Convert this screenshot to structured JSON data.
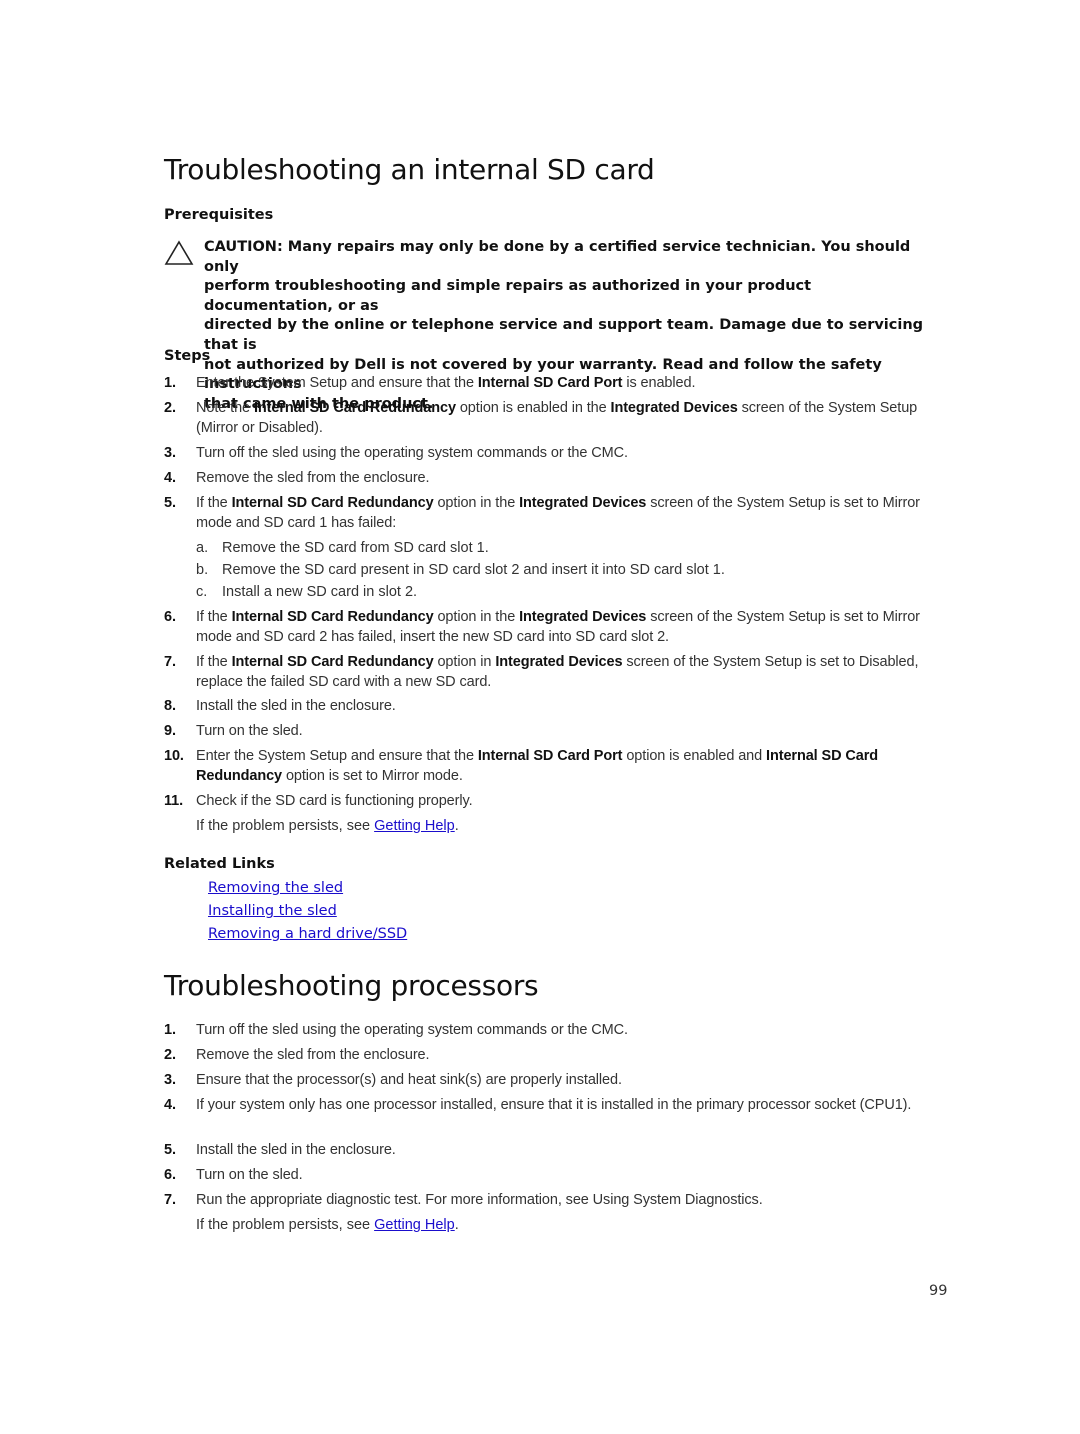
{
  "section1": {
    "title": "Troubleshooting an internal SD card",
    "prerequisites_label": "Prerequisites",
    "caution": {
      "icon": "caution-triangle-icon",
      "lines": [
        "CAUTION: Many repairs may only be done by a certified service technician. You should only",
        "perform troubleshooting and simple repairs as authorized in your product documentation, or as",
        "directed by the online or telephone service and support team. Damage due to servicing that is",
        "not authorized by Dell is not covered by your warranty. Read and follow the safety instructions",
        "that came with the product."
      ]
    },
    "steps_label": "Steps",
    "steps": [
      {
        "num": "1.",
        "parts": [
          [
            "t",
            "Enter the System Setup and ensure that the "
          ],
          [
            "b",
            "Internal SD Card Port"
          ],
          [
            "t",
            " is enabled."
          ]
        ]
      },
      {
        "num": "2.",
        "parts": [
          [
            "t",
            "Note the "
          ],
          [
            "b",
            "Internal SD Card Redundancy"
          ],
          [
            "t",
            " option is enabled in the "
          ],
          [
            "b",
            "Integrated Devices"
          ],
          [
            "t",
            " screen of the System Setup (Mirror or Disabled)."
          ]
        ]
      },
      {
        "num": "3.",
        "parts": [
          [
            "t",
            "Turn off the sled using the operating system commands or the CMC."
          ]
        ]
      },
      {
        "num": "4.",
        "parts": [
          [
            "t",
            "Remove the sled from the enclosure."
          ]
        ]
      },
      {
        "num": "5.",
        "parts": [
          [
            "t",
            "If the "
          ],
          [
            "b",
            "Internal SD Card Redundancy"
          ],
          [
            "t",
            " option in the "
          ],
          [
            "b",
            "Integrated Devices"
          ],
          [
            "t",
            " screen of the System Setup is set to Mirror mode and SD card 1 has failed:"
          ]
        ],
        "substeps": [
          {
            "letter": "a.",
            "text": "Remove the SD card from SD card slot 1."
          },
          {
            "letter": "b.",
            "text": "Remove the SD card present in SD card slot 2 and insert it into SD card slot 1."
          },
          {
            "letter": "c.",
            "text": "Install a new SD card in slot 2."
          }
        ]
      },
      {
        "num": "6.",
        "parts": [
          [
            "t",
            "If the "
          ],
          [
            "b",
            "Internal SD Card Redundancy"
          ],
          [
            "t",
            " option in the "
          ],
          [
            "b",
            "Integrated Devices"
          ],
          [
            "t",
            " screen of the System Setup is set to Mirror mode and SD card 2 has failed, insert the new SD card into SD card slot 2."
          ]
        ]
      },
      {
        "num": "7.",
        "parts": [
          [
            "t",
            "If the "
          ],
          [
            "b",
            "Internal SD Card Redundancy"
          ],
          [
            "t",
            " option in "
          ],
          [
            "b",
            "Integrated Devices"
          ],
          [
            "t",
            " screen of the System Setup is set to Disabled, replace the failed SD card with a new SD card."
          ]
        ]
      },
      {
        "num": "8.",
        "parts": [
          [
            "t",
            "Install the sled in the enclosure."
          ]
        ]
      },
      {
        "num": "9.",
        "parts": [
          [
            "t",
            "Turn on the sled."
          ]
        ]
      },
      {
        "num": "10.",
        "parts": [
          [
            "t",
            "Enter the System Setup and ensure that the "
          ],
          [
            "b",
            "Internal SD Card Port"
          ],
          [
            "t",
            " option is enabled and "
          ],
          [
            "b",
            "Internal SD Card Redundancy"
          ],
          [
            "t",
            " option is set to Mirror mode."
          ]
        ]
      },
      {
        "num": "11.",
        "parts": [
          [
            "t",
            "Check if the SD card is functioning properly."
          ]
        ]
      }
    ],
    "persist_text": "If the problem persists, see ",
    "persist_link": "Getting Help",
    "persist_end": ".",
    "related_label": "Related Links",
    "related_links": [
      "Removing the sled",
      "Installing the sled",
      "Removing a hard drive/SSD"
    ]
  },
  "section2": {
    "title": "Troubleshooting processors",
    "steps": [
      {
        "num": "1.",
        "parts": [
          [
            "t",
            "Turn off the sled using the operating system commands or the CMC."
          ]
        ]
      },
      {
        "num": "2.",
        "parts": [
          [
            "t",
            "Remove the sled from the enclosure."
          ]
        ]
      },
      {
        "num": "3.",
        "parts": [
          [
            "t",
            "Ensure that the processor(s) and heat sink(s) are properly installed."
          ]
        ]
      },
      {
        "num": "4.",
        "parts": [
          [
            "t",
            "If your system only has one processor installed, ensure that it is installed in the primary processor socket (CPU1)."
          ]
        ]
      },
      {
        "num": "5.",
        "parts": [
          [
            "t",
            "Install the sled in the enclosure."
          ]
        ]
      },
      {
        "num": "6.",
        "parts": [
          [
            "t",
            "Turn on the sled."
          ]
        ]
      },
      {
        "num": "7.",
        "parts": [
          [
            "t",
            "Run the appropriate diagnostic test. For more information, see Using System Diagnostics."
          ]
        ]
      }
    ],
    "persist_text": "If the problem persists, see ",
    "persist_link": "Getting Help",
    "persist_end": "."
  },
  "footer": {
    "page_number": "99"
  }
}
